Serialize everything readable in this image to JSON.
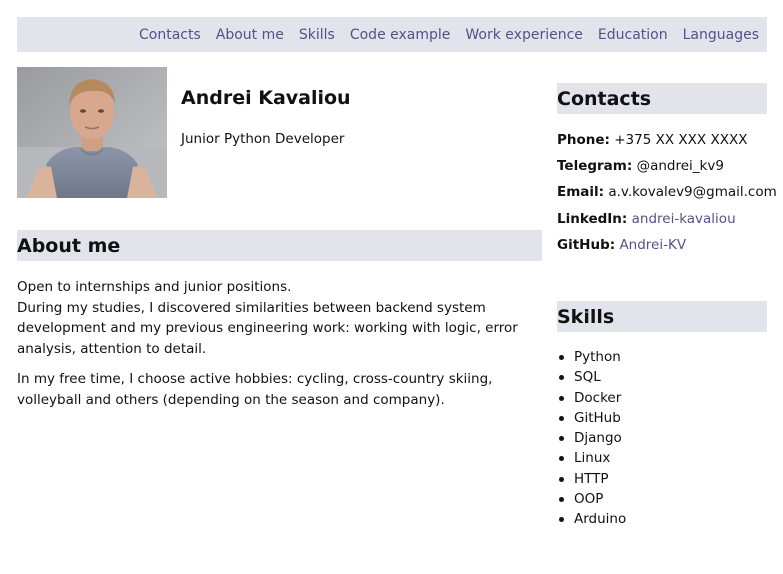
{
  "nav": {
    "items": [
      "Contacts",
      "About me",
      "Skills",
      "Code example",
      "Work experience",
      "Education",
      "Languages"
    ]
  },
  "profile": {
    "name": "Andrei Kavaliou",
    "position": "Junior Python Developer"
  },
  "about": {
    "heading": "About me",
    "paragraph1_line1": "Open to internships and junior positions.",
    "paragraph1_line2": "During my studies, I discovered similarities between backend system development and my previous engineering work: working with logic, error analysis, attention to detail.",
    "paragraph2": "In my free time, I choose active hobbies: cycling, cross-country skiing, volleyball and others (depending on the season and company)."
  },
  "contacts": {
    "heading": "Contacts",
    "phone_label": "Phone:",
    "phone_value": "+375 XX XXX XXXX",
    "telegram_label": "Telegram:",
    "telegram_value": "@andrei_kv9",
    "email_label": "Email:",
    "email_value": "a.v.kovalev9@gmail.com",
    "linkedin_label": "LinkedIn:",
    "linkedin_value": "andrei-kavaliou",
    "github_label": "GitHub:",
    "github_value": "Andrei-KV"
  },
  "skills": {
    "heading": "Skills",
    "items": [
      "Python",
      "SQL",
      "Docker",
      "GitHub",
      "Django",
      "Linux",
      "HTTP",
      "OOP",
      "Arduino"
    ]
  },
  "colors": {
    "accent": "#56508a",
    "section_bg": "#e3e3ec"
  }
}
